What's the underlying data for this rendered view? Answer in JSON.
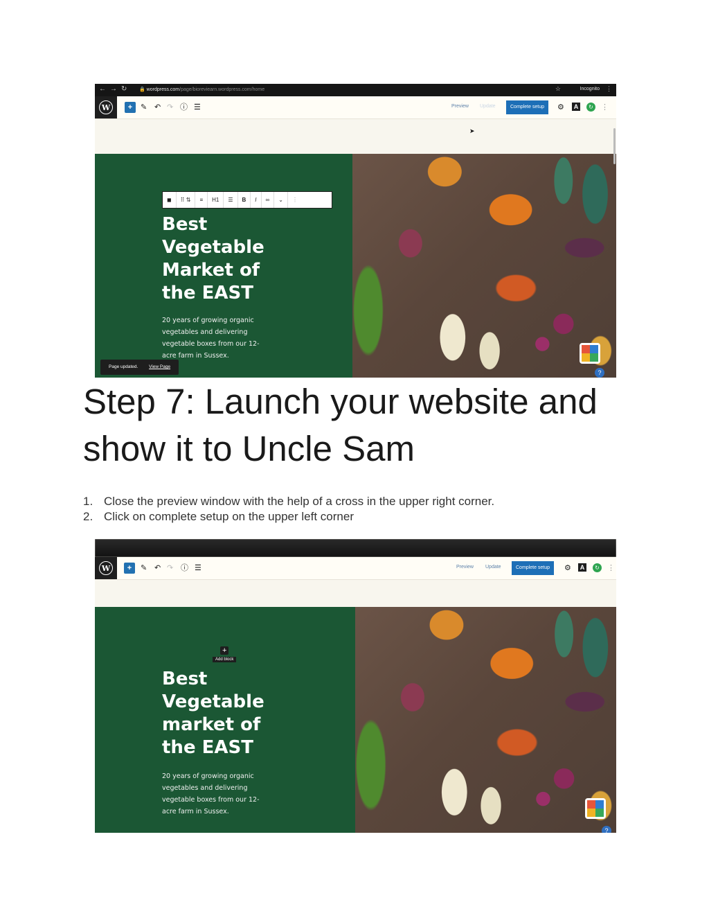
{
  "screenshot1": {
    "browser": {
      "url_domain": "wordpress.com",
      "url_path": "/page/bioreviearn.wordpress.com/home",
      "profile": "Incognito"
    },
    "editor": {
      "preview_label": "Preview",
      "update_label": "Update",
      "complete_setup_label": "Complete setup"
    },
    "block_toolbar": {
      "heading_level": "H1",
      "bold": "B",
      "italic": "I"
    },
    "hero": {
      "title_lines": [
        "Best",
        "Vegetable",
        "Market of",
        "the EAST"
      ],
      "description": "20 years of growing organic vegetables and delivering vegetable boxes from our 12-acre farm in Sussex."
    },
    "snackbar": {
      "message": "Page updated.",
      "link": "View Page"
    }
  },
  "document": {
    "title": "Step 7: Launch your website and show it to Uncle Sam",
    "steps": [
      {
        "num": "1.",
        "text": "Close the preview window with the help of a cross in the upper right corner."
      },
      {
        "num": "2.",
        "text": "Click on complete setup on the upper left corner"
      }
    ]
  },
  "screenshot2": {
    "editor": {
      "preview_label": "Preview",
      "update_label": "Update",
      "complete_setup_label": "Complete setup"
    },
    "add_block_label": "Add block",
    "hero": {
      "title_lines": [
        "Best",
        "Vegetable",
        "market of",
        "the EAST"
      ],
      "description": "20 years of growing organic vegetables and delivering vegetable boxes from our 12-acre farm in Sussex."
    }
  },
  "icons": [
    "wordpress-logo-icon",
    "plus-icon",
    "pencil-icon",
    "undo-icon",
    "redo-icon",
    "info-icon",
    "list-view-icon",
    "gear-icon",
    "user-avatar-icon",
    "help-icon"
  ],
  "colors": {
    "hero_green": "#1b5734",
    "wp_blue": "#1d6fb7"
  }
}
